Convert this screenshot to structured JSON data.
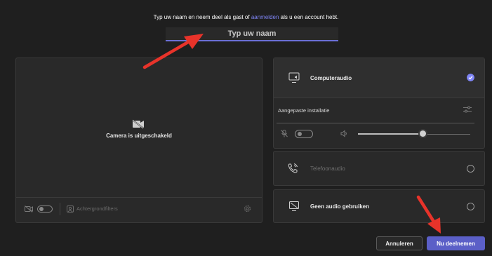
{
  "header": {
    "prompt_before": "Typ uw naam en neem deel als gast of ",
    "prompt_link": "aanmelden",
    "prompt_after": " als u een account hebt.",
    "name_placeholder": "Typ uw naam"
  },
  "video": {
    "camera_off_label": "Camera is uitgeschakeld",
    "background_filters_label": "Achtergrondfilters",
    "camera_toggle_on": false
  },
  "audio": {
    "computer_audio": {
      "label": "Computeraudio",
      "selected": true
    },
    "custom_setup_label": "Aangepaste installatie",
    "mic_toggle_on": false,
    "speaker_volume": 0.58,
    "phone_audio": {
      "label": "Telefoonaudio",
      "selected": false
    },
    "no_audio": {
      "label": "Geen audio gebruiken",
      "selected": false
    }
  },
  "actions": {
    "cancel_label": "Annuleren",
    "join_label": "Nu deelnemen"
  },
  "colors": {
    "accent": "#5b5fc7",
    "link": "#7f85f5",
    "annotation_arrow": "#e8332a"
  }
}
